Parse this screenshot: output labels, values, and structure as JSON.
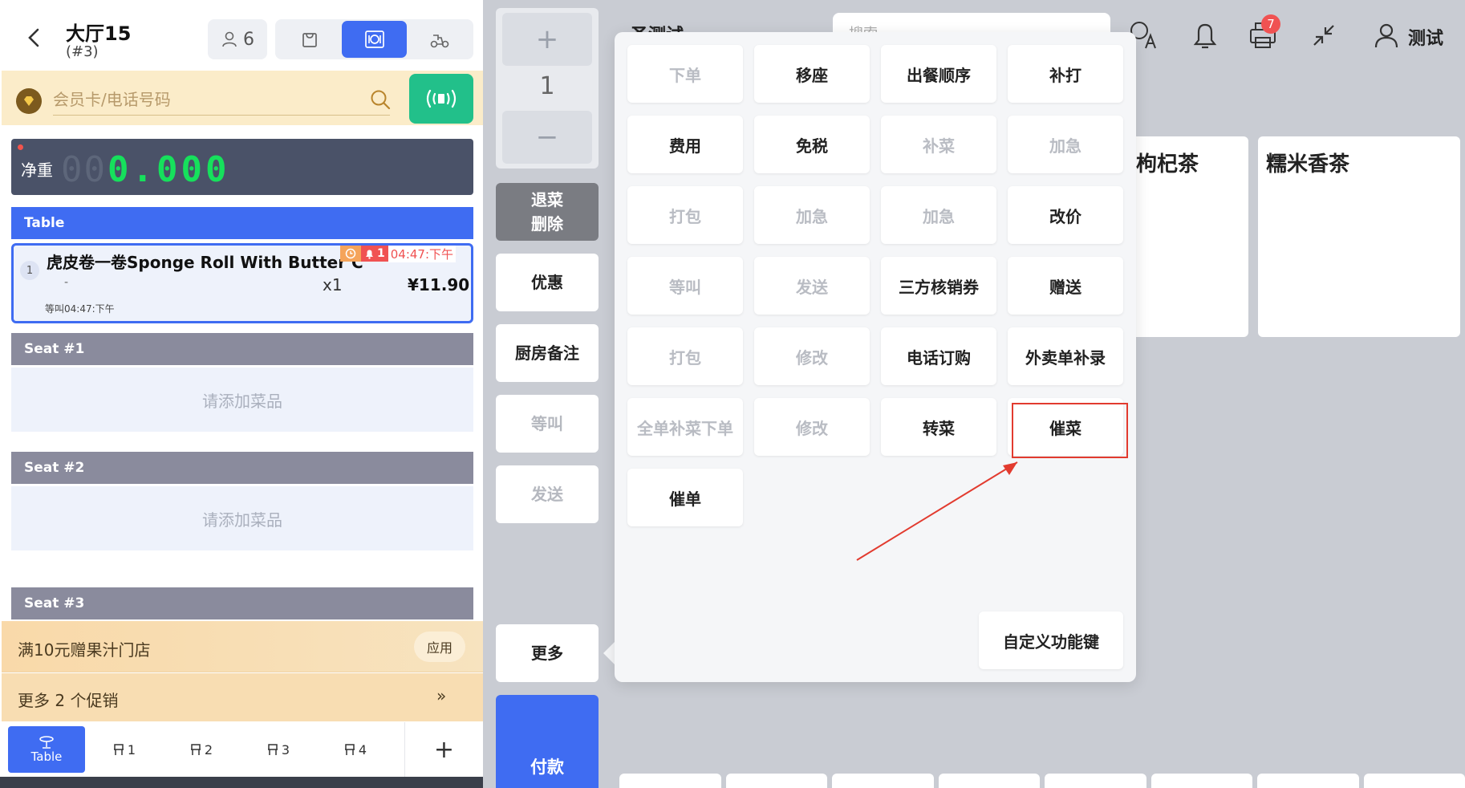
{
  "header": {
    "title": "大厅15",
    "subtitle": "(#3)",
    "guest_count": "6"
  },
  "member": {
    "placeholder": "会员卡/电话号码"
  },
  "scale": {
    "label": "净重",
    "ghost": "00",
    "value": "0.000"
  },
  "table_section": {
    "label": "Table"
  },
  "order_item": {
    "index": "1",
    "name": "虎皮卷一卷Sponge Roll With Butter Cream",
    "bell_count": "1",
    "time": "04:47:下午",
    "dash": "-",
    "qty": "x1",
    "price": "¥11.90",
    "note": "等叫04:47:下午"
  },
  "seats": [
    {
      "label": "Seat #1",
      "empty": "请添加菜品"
    },
    {
      "label": "Seat #2",
      "empty": "请添加菜品"
    },
    {
      "label": "Seat #3"
    }
  ],
  "promo": {
    "text": "满10元赠果汁门店",
    "apply": "应用",
    "more": "更多 2 个促销",
    "more_arrow": "»"
  },
  "bottom_tabs": [
    {
      "label": "Table"
    },
    {
      "label": "1"
    },
    {
      "label": "2"
    },
    {
      "label": "3"
    },
    {
      "label": "4"
    }
  ],
  "add_tab": "+",
  "stepper": {
    "plus": "+",
    "value": "1",
    "minus": "−"
  },
  "side_buttons": {
    "return_line1": "退菜",
    "return_line2": "删除",
    "discount": "优惠",
    "kitchen_note": "厨房备注",
    "wait": "等叫",
    "send": "发送",
    "more": "更多",
    "pay": "付款"
  },
  "topbar": {
    "title": "圣测试",
    "search_placeholder": "搜索",
    "notif_badge": "7",
    "user": "测试"
  },
  "products": [
    {
      "name": "枸杞茶"
    },
    {
      "name": "糯米香茶"
    }
  ],
  "popup": {
    "buttons": [
      {
        "label": "下单",
        "enabled": false
      },
      {
        "label": "移座",
        "enabled": true
      },
      {
        "label": "出餐顺序",
        "enabled": true
      },
      {
        "label": "补打",
        "enabled": true
      },
      {
        "label": "费用",
        "enabled": true
      },
      {
        "label": "免税",
        "enabled": true
      },
      {
        "label": "补菜",
        "enabled": false
      },
      {
        "label": "加急",
        "enabled": false
      },
      {
        "label": "打包",
        "enabled": false
      },
      {
        "label": "加急",
        "enabled": false
      },
      {
        "label": "加急",
        "enabled": false
      },
      {
        "label": "改价",
        "enabled": true
      },
      {
        "label": "等叫",
        "enabled": false
      },
      {
        "label": "发送",
        "enabled": false
      },
      {
        "label": "三方核销券",
        "enabled": true
      },
      {
        "label": "赠送",
        "enabled": true
      },
      {
        "label": "打包",
        "enabled": false
      },
      {
        "label": "修改",
        "enabled": false
      },
      {
        "label": "电话订购",
        "enabled": true
      },
      {
        "label": "外卖单补录",
        "enabled": true
      },
      {
        "label": "全单补菜下单",
        "enabled": false
      },
      {
        "label": "修改",
        "enabled": false
      },
      {
        "label": "转菜",
        "enabled": true
      },
      {
        "label": "催菜",
        "enabled": true
      },
      {
        "label": "催单",
        "enabled": true
      }
    ],
    "custom": "自定义功能键"
  },
  "colors": {
    "primary": "#3f6cf2",
    "green": "#22c08a",
    "highlight": "#e23b2f",
    "seat_bar": "#8a8b9d"
  }
}
